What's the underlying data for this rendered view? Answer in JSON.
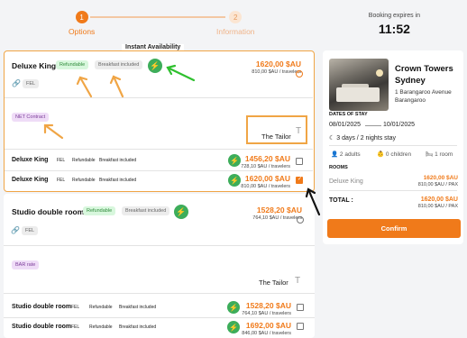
{
  "stepper": {
    "steps": [
      {
        "number": "1",
        "label": "Options"
      },
      {
        "number": "2",
        "label": "Information"
      }
    ],
    "expiry_label": "Booking expires in",
    "expiry_time": "11:52"
  },
  "availability_label": "Instant Availability",
  "deluxe": {
    "title": "Deluxe King",
    "tag_refundable": "Refundable",
    "tag_breakfast": "Breakfast included",
    "fel": "FEL",
    "price": "1620,00 $AU",
    "price_sub": "810,00 $AU / travelers",
    "contract": "NET Contract",
    "supplier": "The Tailor",
    "rows": [
      {
        "title": "Deluxe King",
        "fel": "FEL",
        "refundable": "Refundable",
        "breakfast": "Breakfast included",
        "price": "1456,20 $AU",
        "sub": "728,10 $AU / travelers",
        "checked": false
      },
      {
        "title": "Deluxe King",
        "fel": "FEL",
        "refundable": "Refundable",
        "breakfast": "Breakfast included",
        "price": "1620,00 $AU",
        "sub": "810,00 $AU / travelers",
        "checked": true
      }
    ]
  },
  "studio": {
    "title": "Studio double room",
    "tag_refundable": "Refundable",
    "tag_breakfast": "Breakfast included",
    "fel": "FEL",
    "price": "1528,20 $AU",
    "price_sub": "764,10 $AU / travelers",
    "rate": "BAR rate",
    "supplier": "The Tailor",
    "rows": [
      {
        "title": "Studio double room",
        "fel": "FEL",
        "refundable": "Refundable",
        "breakfast": "Breakfast included",
        "price": "1528,20 $AU",
        "sub": "764,10 $AU / travelers",
        "checked": false
      },
      {
        "title": "Studio double room",
        "fel": "FEL",
        "refundable": "Refundable",
        "breakfast": "Breakfast included",
        "price": "1692,00 $AU",
        "sub": "846,00 $AU / travelers",
        "checked": false
      }
    ]
  },
  "summary": {
    "hotel_name_line1": "Crown Towers",
    "hotel_name_line2": "Sydney",
    "address_line1": "1 Barangaroo Avenue",
    "address_line2": "Barangaroo",
    "dates_label": "DATES OF STAY",
    "date_from": "08/01/2025",
    "date_to": "10/01/2025",
    "nights": "3 days / 2 nights stay",
    "adults": "2 adults",
    "children": "0 children",
    "rooms_count": "1 room",
    "rooms_label": "ROOMS",
    "room_name": "Deluxe King",
    "room_price": "1620,00 $AU",
    "room_price_sub": "810,00 $AU / PAX",
    "total_label": "TOTAL :",
    "total_price": "1620,00 $AU",
    "total_price_sub": "810,00 $AU / PAX",
    "confirm": "Confirm"
  },
  "colors": {
    "accent": "#f07a1a",
    "green": "#3dad5a",
    "highlight": "#f0a545"
  }
}
